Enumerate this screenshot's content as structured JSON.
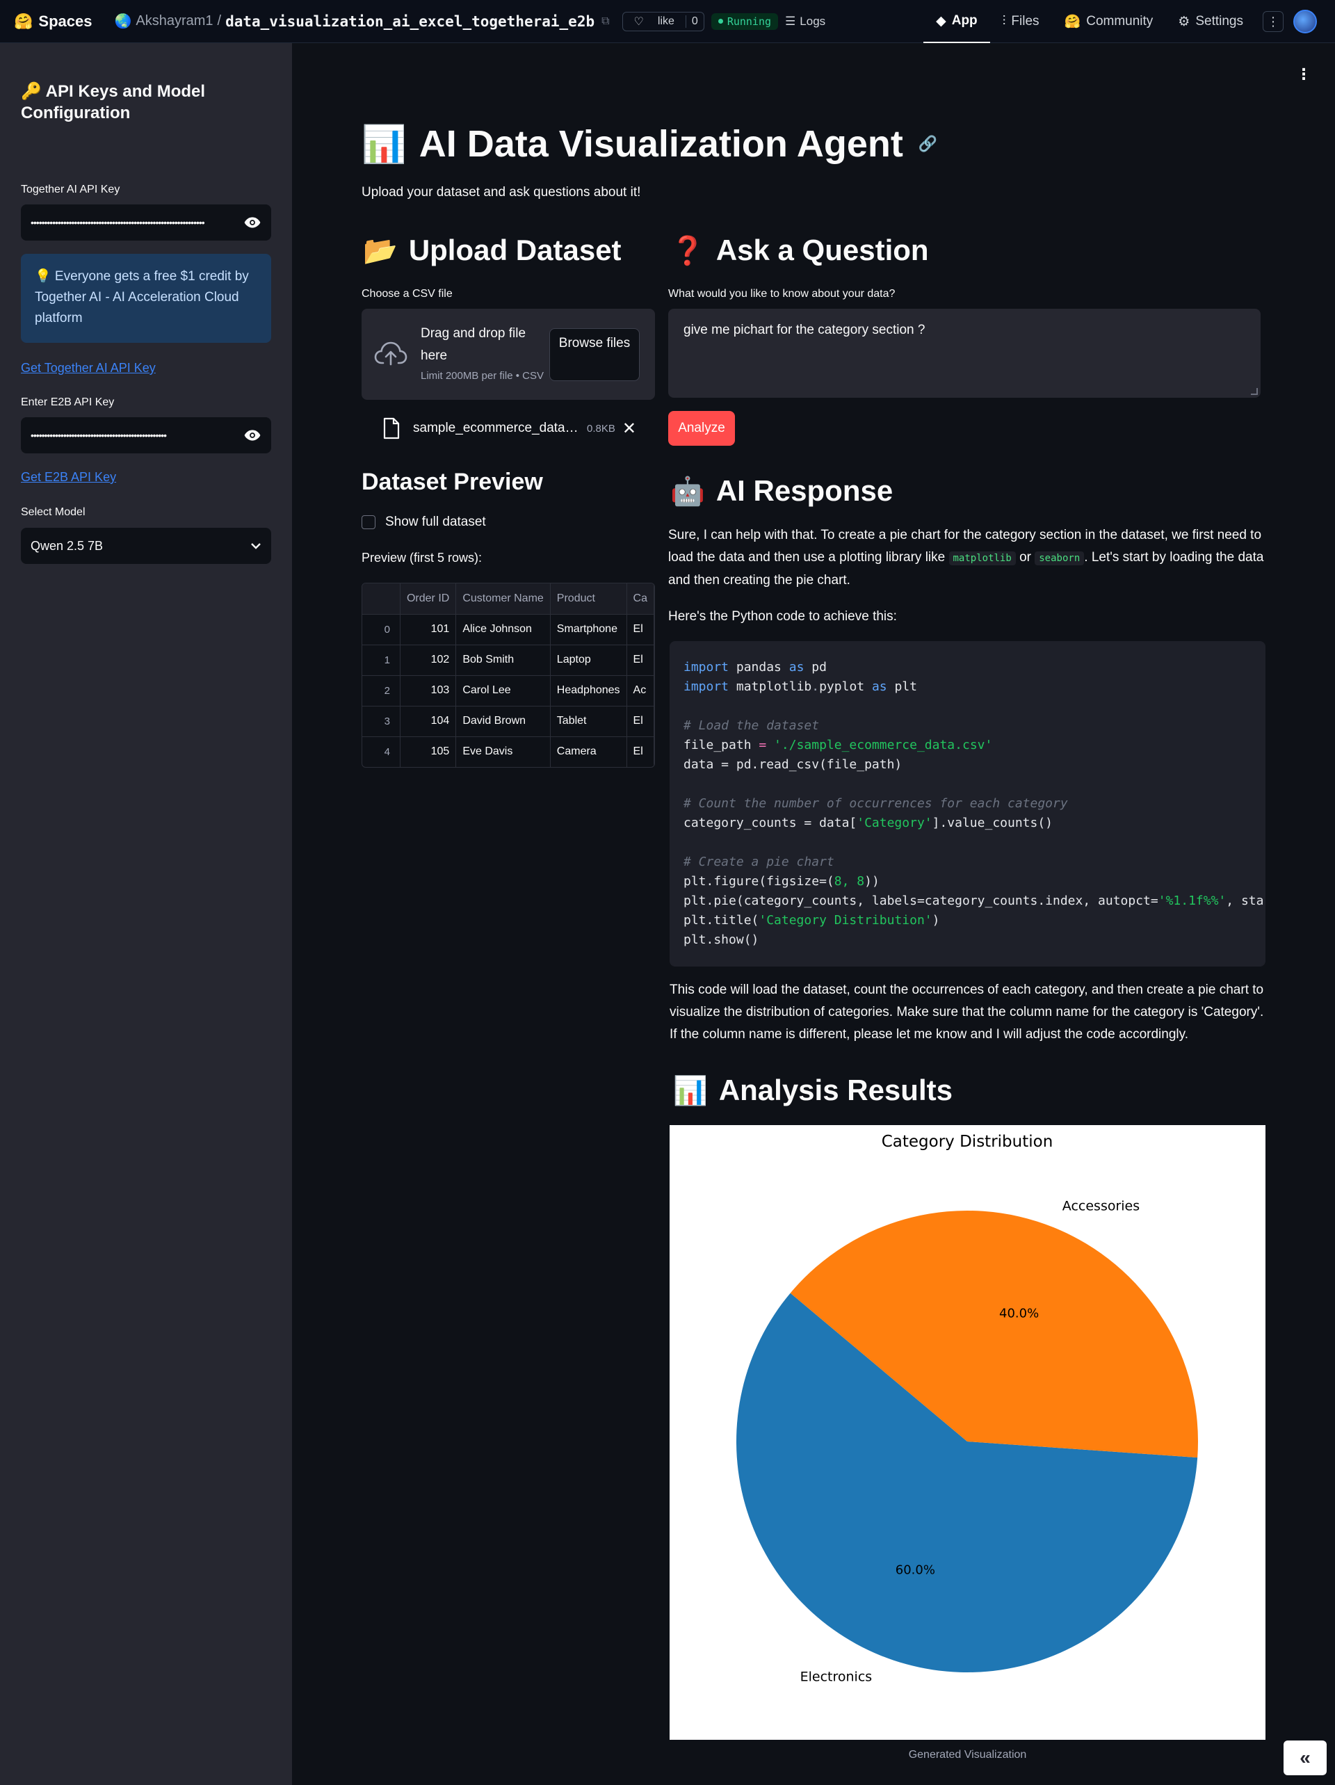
{
  "topbar": {
    "brand": "Spaces",
    "owner": "Akshayram1",
    "separator": "/",
    "repo": "data_visualization_ai_excel_togetherai_e2b",
    "like_label": "like",
    "like_count": "0",
    "status": "Running",
    "logs_label": "Logs",
    "tabs": [
      {
        "label": "App",
        "icon": "cube-icon"
      },
      {
        "label": "Files",
        "icon": "files-icon"
      },
      {
        "label": "Community",
        "icon": "community-icon"
      },
      {
        "label": "Settings",
        "icon": "gear-icon"
      }
    ]
  },
  "sidebar": {
    "title": "🔑 API Keys and Model Configuration",
    "together_label": "Together AI API Key",
    "together_value": "••••••••••••••••••••••••••••••••••••••••••••••••••••••••••••••••",
    "info_text": "💡 Everyone gets a free $1 credit by Together AI - AI Acceleration Cloud platform",
    "together_link": "Get Together AI API Key",
    "e2b_label": "Enter E2B API Key",
    "e2b_value": "••••••••••••••••••••••••••••••••••••••••••••••••••",
    "e2b_link": "Get E2B API Key",
    "model_label": "Select Model",
    "model_value": "Qwen 2.5 7B"
  },
  "main": {
    "title_emoji": "📊",
    "title": "AI Data Visualization Agent",
    "subtitle": "Upload your dataset and ask questions about it!",
    "upload": {
      "heading_emoji": "📂",
      "heading": "Upload Dataset",
      "label": "Choose a CSV file",
      "drag_text": "Drag and drop file here",
      "limit_text": "Limit 200MB per file • CSV",
      "browse_label": "Browse files",
      "file_name": "sample_ecommerce_data.csv",
      "file_size": "0.8KB"
    },
    "preview": {
      "heading": "Dataset Preview",
      "checkbox_label": "Show full dataset",
      "caption": "Preview (first 5 rows):",
      "columns": [
        "",
        "Order ID",
        "Customer Name",
        "Product",
        "Ca"
      ],
      "rows": [
        [
          "0",
          "101",
          "Alice Johnson",
          "Smartphone",
          "El"
        ],
        [
          "1",
          "102",
          "Bob Smith",
          "Laptop",
          "El"
        ],
        [
          "2",
          "103",
          "Carol Lee",
          "Headphones",
          "Ac"
        ],
        [
          "3",
          "104",
          "David Brown",
          "Tablet",
          "El"
        ],
        [
          "4",
          "105",
          "Eve Davis",
          "Camera",
          "El"
        ]
      ]
    },
    "question": {
      "heading_emoji": "❓",
      "heading": "Ask a Question",
      "label": "What would you like to know about your data?",
      "value": "give me pichart for the category section ?",
      "analyze_label": "Analyze"
    },
    "response": {
      "heading_emoji": "🤖",
      "heading": "AI Response",
      "p1_a": "Sure, I can help with that. To create a pie chart for the category section in the dataset, we first need to load the data and then use a plotting library like ",
      "p1_code1": "matplotlib",
      "p1_or": " or ",
      "p1_code2": "seaborn",
      "p1_b": ". Let's start by loading the data and then creating the pie chart.",
      "p2": "Here's the Python code to achieve this:",
      "p3": "This code will load the dataset, count the occurrences of each category, and then create a pie chart to visualize the distribution of categories. Make sure that the column name for the category is 'Category'. If the column name is different, please let me know and I will adjust the code accordingly."
    },
    "results": {
      "heading_emoji": "📊",
      "heading": "Analysis Results",
      "caption": "Generated Visualization"
    }
  },
  "code": {
    "l1_kw1": "import",
    "l1_mod": " pandas ",
    "l1_kw2": "as",
    "l1_alias": " pd",
    "l2_kw1": "import",
    "l2_mod": " matplotlib",
    "l2_dot": ".",
    "l2_sub": "pyplot ",
    "l2_kw2": "as",
    "l2_alias": " plt",
    "l4": "# Load the dataset",
    "l5_var": "file_path ",
    "l5_eq": "=",
    "l5_str": " './sample_ecommerce_data.csv'",
    "l6": "data = pd.read_csv(file_path)",
    "l8": "# Count the number of occurrences for each category",
    "l9_a": "category_counts = data[",
    "l9_str": "'Category'",
    "l9_b": "].value_counts()",
    "l11": "# Create a pie chart",
    "l12_a": "plt.figure(figsize=(",
    "l12_n": "8, 8",
    "l12_b": "))",
    "l13_a": "plt.pie(category_counts, labels=category_counts.index, autopct=",
    "l13_str": "'%1.1f%%'",
    "l13_b": ", starta",
    "l14_a": "plt.title(",
    "l14_str": "'Category Distribution'",
    "l14_b": ")",
    "l15": "plt.show()"
  },
  "chart_data": {
    "type": "pie",
    "title": "Category Distribution",
    "categories": [
      "Electronics",
      "Accessories"
    ],
    "values": [
      60.0,
      40.0
    ],
    "value_labels": [
      "60.0%",
      "40.0%"
    ],
    "colors": [
      "#1f77b4",
      "#ff7f0e"
    ]
  }
}
